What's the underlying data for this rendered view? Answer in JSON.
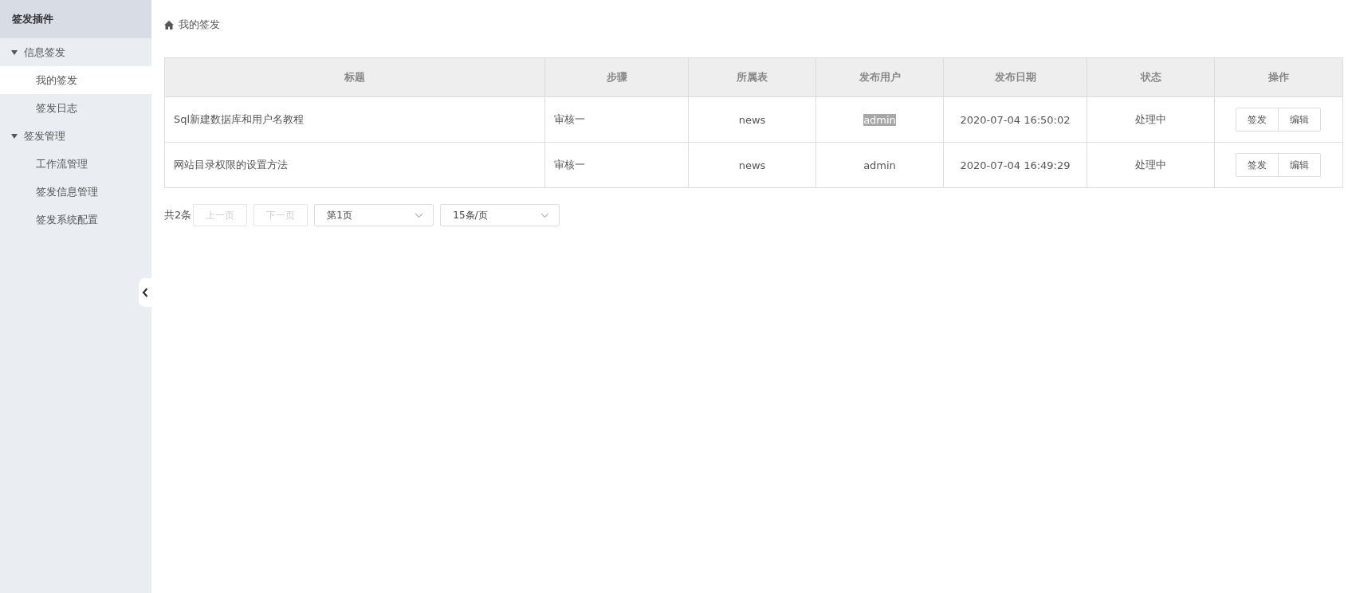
{
  "sidebar": {
    "title": "签发插件",
    "groups": [
      {
        "label": "信息签发",
        "expanded": true,
        "children": [
          {
            "label": "我的签发",
            "selected": true
          },
          {
            "label": "签发日志",
            "selected": false
          }
        ]
      },
      {
        "label": "签发管理",
        "expanded": true,
        "children": [
          {
            "label": "工作流管理",
            "selected": false
          },
          {
            "label": "签发信息管理",
            "selected": false
          },
          {
            "label": "签发系统配置",
            "selected": false
          }
        ]
      }
    ]
  },
  "breadcrumb": "我的签发",
  "table": {
    "columns": [
      "标题",
      "步骤",
      "所属表",
      "发布用户",
      "发布日期",
      "状态",
      "操作"
    ],
    "rows": [
      {
        "title": "Sql新建数据库和用户名教程",
        "step": "审核一",
        "table": "news",
        "user": "admin",
        "user_highlighted": true,
        "date": "2020-07-04 16:50:02",
        "status": "处理中",
        "actions": [
          "签发",
          "编辑"
        ]
      },
      {
        "title": "网站目录权限的设置方法",
        "step": "审核一",
        "table": "news",
        "user": "admin",
        "user_highlighted": false,
        "date": "2020-07-04 16:49:29",
        "status": "处理中",
        "actions": [
          "签发",
          "编辑"
        ]
      }
    ]
  },
  "pagination": {
    "total": "共2条",
    "prev": {
      "label": "上一页",
      "disabled": true
    },
    "next": {
      "label": "下一页",
      "disabled": true
    },
    "page": "第1页",
    "page_size": "15条/页"
  }
}
